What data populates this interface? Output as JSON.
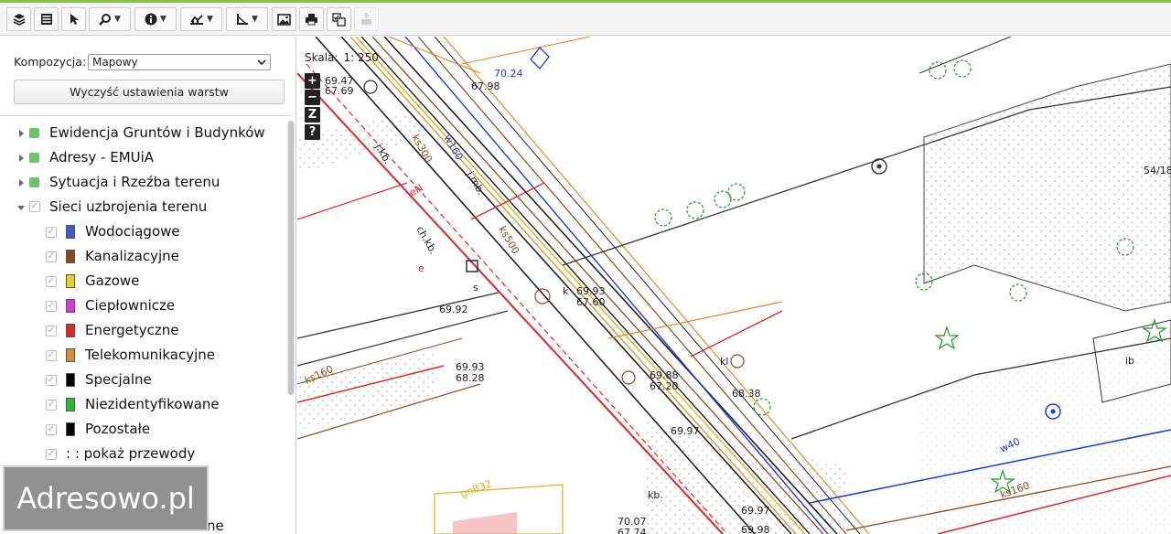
{
  "toolbar": {
    "buttons": [
      {
        "name": "layers-icon",
        "caret": false
      },
      {
        "name": "list-icon",
        "caret": false
      },
      {
        "name": "pointer-icon",
        "caret": false
      },
      {
        "name": "zoom-icon",
        "caret": true
      },
      {
        "name": "info-icon",
        "caret": true
      },
      {
        "name": "measure-icon",
        "caret": true
      },
      {
        "name": "angle-icon",
        "caret": true
      },
      {
        "name": "image-icon",
        "caret": false
      },
      {
        "name": "print-icon",
        "caret": false
      },
      {
        "name": "compare-icon",
        "caret": false
      },
      {
        "name": "export-icon",
        "caret": false
      }
    ]
  },
  "panel": {
    "kompozycja_label": "Kompozycja:",
    "kompozycja_value": "Mapowy",
    "clear_button": "Wyczyść ustawienia warstw",
    "groups": [
      {
        "label": "Ewidencja Gruntów i Budynków",
        "expanded": false
      },
      {
        "label": "Adresy - EMUiA",
        "expanded": false
      },
      {
        "label": "Sytuacja i Rzeźba terenu",
        "expanded": false
      },
      {
        "label": "Sieci uzbrojenia terenu",
        "expanded": true
      }
    ],
    "sublayers": [
      {
        "label": "Wodociągowe",
        "color": "#3b5bdb"
      },
      {
        "label": "Kanalizacyjne",
        "color": "#8b4a1e"
      },
      {
        "label": "Gazowe",
        "color": "#e6d21a"
      },
      {
        "label": "Ciepłownicze",
        "color": "#e233d6"
      },
      {
        "label": "Energetyczne",
        "color": "#e22424"
      },
      {
        "label": "Telekomunikacyjne",
        "color": "#e08a2c"
      },
      {
        "label": "Specjalne",
        "color": "#000000"
      },
      {
        "label": "Niezidentyfikowane",
        "color": "#24c024"
      },
      {
        "label": "Pozostałe",
        "color": "#000000"
      }
    ],
    "show_wires": ": : pokaż przewody",
    "cut_text": "ne"
  },
  "map": {
    "scale_label": "Skala:",
    "scale_value": "1: 250",
    "zoom_in": "+",
    "zoom_out": "−",
    "zoom_extent": "Z",
    "help": "?",
    "labels": [
      {
        "t": "70.24",
        "c": "#1d3bd1"
      },
      {
        "t": "67.98",
        "c": "#222"
      },
      {
        "t": "69.47",
        "c": "#222"
      },
      {
        "t": "67.69",
        "c": "#222"
      },
      {
        "t": "j.kb.",
        "c": "#222"
      },
      {
        "t": "ks300",
        "c": "#8b4a1e"
      },
      {
        "t": "w160",
        "c": "#1d3bd1"
      },
      {
        "t": "j.mb.",
        "c": "#222"
      },
      {
        "t": "ks500",
        "c": "#8b4a1e"
      },
      {
        "t": "ch.kb.",
        "c": "#222"
      },
      {
        "t": "69.92",
        "c": "#222"
      },
      {
        "t": "69.93",
        "c": "#222"
      },
      {
        "t": "67.60",
        "c": "#222"
      },
      {
        "t": "69.93",
        "c": "#222"
      },
      {
        "t": "68.28",
        "c": "#222"
      },
      {
        "t": "ks160",
        "c": "#8b4a1e"
      },
      {
        "t": "69.88",
        "c": "#222"
      },
      {
        "t": "67.20",
        "c": "#222"
      },
      {
        "t": "68.38",
        "c": "#222"
      },
      {
        "t": "69.97",
        "c": "#222"
      },
      {
        "t": "w40",
        "c": "#1d3bd1"
      },
      {
        "t": "ks160",
        "c": "#8b4a1e"
      },
      {
        "t": "ib",
        "c": "#222"
      },
      {
        "t": "54/18",
        "c": "#222"
      },
      {
        "t": "70.07",
        "c": "#222"
      },
      {
        "t": "67.74",
        "c": "#222"
      },
      {
        "t": "69.97",
        "c": "#222"
      },
      {
        "t": "69.98",
        "c": "#222"
      },
      {
        "t": "kb.",
        "c": "#222"
      },
      {
        "t": "gnB32",
        "c": "#e0b020"
      },
      {
        "t": "eN",
        "c": "#e22424"
      },
      {
        "t": "kl",
        "c": "#222"
      },
      {
        "t": "k",
        "c": "#222"
      },
      {
        "t": "s",
        "c": "#222"
      },
      {
        "t": "e",
        "c": "#e22424"
      }
    ]
  }
}
